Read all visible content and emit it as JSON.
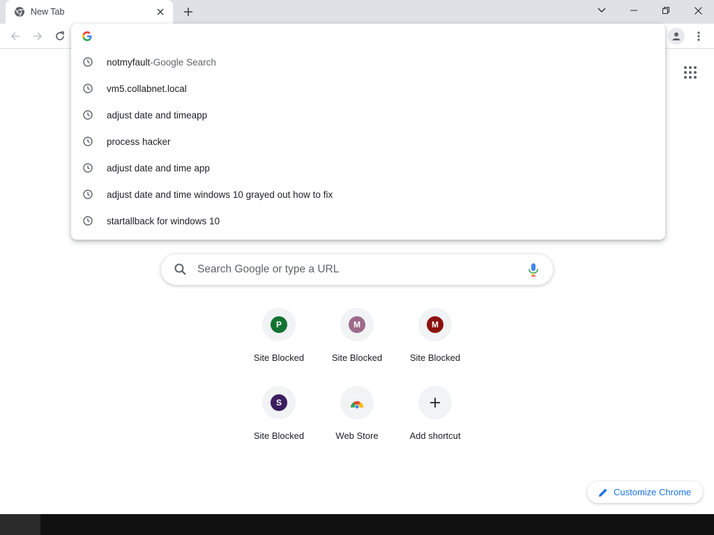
{
  "tab": {
    "title": "New Tab"
  },
  "omnibox": {
    "value": "",
    "suggestions": [
      {
        "text": "notmyfault",
        "separator": " - ",
        "description": "Google Search"
      },
      {
        "text": "vm5.collabnet.local"
      },
      {
        "text": "adjust date and timeapp"
      },
      {
        "text": "process hacker"
      },
      {
        "text": "adjust date and time app"
      },
      {
        "text": "adjust date and time windows 10 grayed out how to fix"
      },
      {
        "text": "startallback for windows 10"
      }
    ]
  },
  "search": {
    "placeholder": "Search Google or type a URL"
  },
  "shortcuts": [
    {
      "letter": "P",
      "label": "Site Blocked",
      "color": "#137333"
    },
    {
      "letter": "M",
      "label": "Site Blocked",
      "color": "#9e6a8a"
    },
    {
      "letter": "M",
      "label": "Site Blocked",
      "color": "#8b1010"
    },
    {
      "letter": "S",
      "label": "Site Blocked",
      "color": "#3c1f5e"
    },
    {
      "letter": "",
      "label": "Web Store",
      "icon": "chrome-web-store-icon"
    },
    {
      "letter": "",
      "label": "Add shortcut",
      "icon": "plus-icon"
    }
  ],
  "customize": {
    "label": "Customize Chrome"
  },
  "colors": {
    "accent": "#1a73e8",
    "tabstrip": "#dee1e6",
    "taskbar": "#101010"
  }
}
